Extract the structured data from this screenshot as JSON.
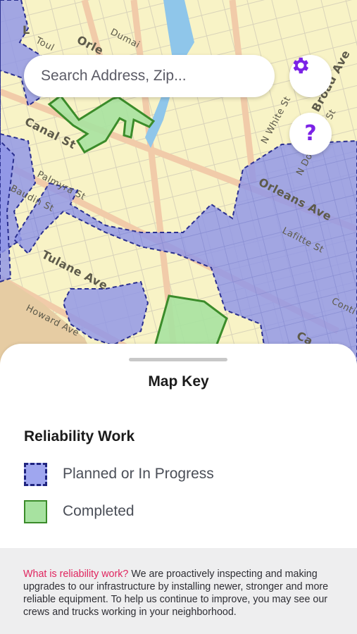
{
  "map": {
    "street_labels": [
      "Canal St",
      "Palmyra St",
      "Tulane Ave",
      "Orleans Ave",
      "Lafitte St",
      "Broad Ave",
      "N White St",
      "N Dorgenois St",
      "Howard Ave",
      "Baudin St",
      "Conti",
      "Ca",
      "Orle",
      "Toul",
      "Dumai",
      "L"
    ],
    "colors": {
      "base": "#f8f3c6",
      "planned_fill": "#8f95e8",
      "planned_stroke": "#2a2f8f",
      "completed_fill": "#a7e2a0",
      "completed_stroke": "#3b8c2a"
    }
  },
  "search": {
    "placeholder": "Search Address, Zip..."
  },
  "settings_button": {
    "icon": "gear-icon",
    "color": "#7b22e6"
  },
  "help_button": {
    "label": "?",
    "color": "#7b22e6"
  },
  "sheet": {
    "title": "Map Key",
    "section_title": "Reliability Work",
    "legend": [
      {
        "label": "Planned or In Progress",
        "swatch": "dashed-blue"
      },
      {
        "label": "Completed",
        "swatch": "solid-green"
      }
    ],
    "info": {
      "lead": "What is reliability work?",
      "body": " We are proactively inspecting and making upgrades to our infrastructure by installing newer, stronger and more reliable equipment. To help us continue to improve, you may see our crews and trucks working in your neighborhood."
    }
  }
}
